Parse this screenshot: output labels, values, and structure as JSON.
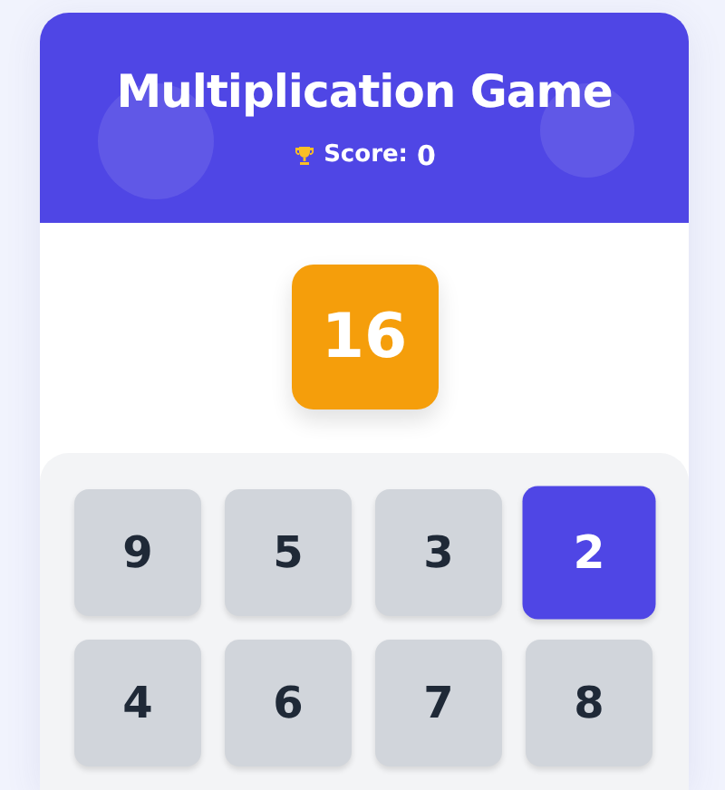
{
  "header": {
    "title": "Multiplication Game",
    "score_label": "Score:",
    "score": "0"
  },
  "target": "16",
  "numbers": [
    {
      "label": "9",
      "selected": false
    },
    {
      "label": "5",
      "selected": false
    },
    {
      "label": "3",
      "selected": false
    },
    {
      "label": "2",
      "selected": true
    },
    {
      "label": "4",
      "selected": false
    },
    {
      "label": "6",
      "selected": false
    },
    {
      "label": "7",
      "selected": false
    },
    {
      "label": "8",
      "selected": false
    }
  ]
}
